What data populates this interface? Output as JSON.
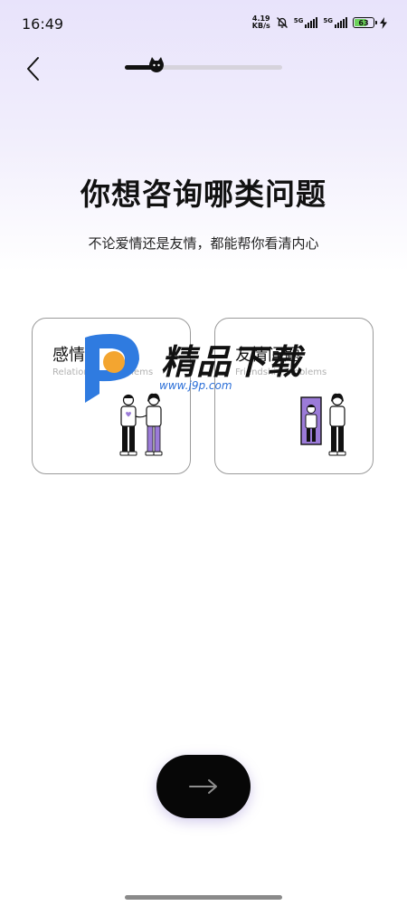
{
  "status_bar": {
    "time": "16:49",
    "net_speed_value": "4.19",
    "net_speed_unit": "KB/s",
    "signal_1_label": "5G",
    "signal_2_label": "5G",
    "battery_level": "63"
  },
  "progress": {
    "fraction": 0.2
  },
  "header": {
    "title": "你想咨询哪类问题",
    "subtitle": "不论爱情还是友情，都能帮你看清内心"
  },
  "options": [
    {
      "title": "感情问题",
      "subtitle": "Relationship problems"
    },
    {
      "title": "友情问题",
      "subtitle": "Friendship problems"
    }
  ],
  "watermark": {
    "brand_text": "精品下载",
    "url_text": "www.j9p.com"
  },
  "colors": {
    "background_top": "#e8e3fb",
    "accent_purple": "#9b7bd8",
    "button_dark": "#070707",
    "battery_green": "#6cd35a"
  },
  "icons": {
    "back": "chevron-left-icon",
    "next": "arrow-right-icon",
    "progress_marker": "cat-icon"
  }
}
